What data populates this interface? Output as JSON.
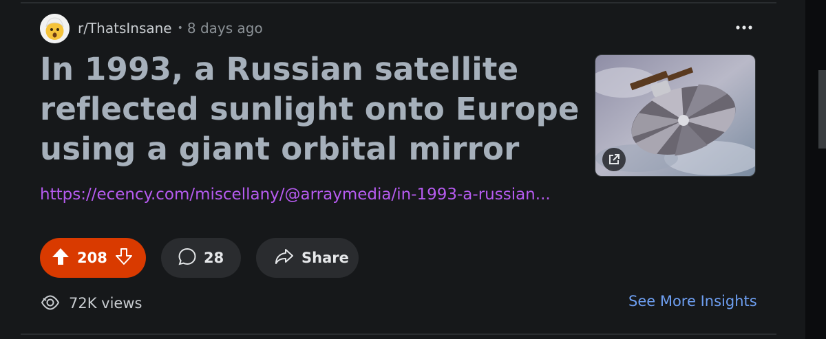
{
  "post": {
    "subreddit": "r/ThatsInsane",
    "separator": "•",
    "age": "8 days ago",
    "title": "In 1993, a Russian satellite reflected sunlight onto Europe using a giant orbital mirror",
    "link_text": "https://ecency.com/miscellany/@arraymedia/in-1993-a-russian...",
    "upvotes": "208",
    "comments": "28",
    "share_label": "Share",
    "views": "72K views",
    "insights_label": "See More Insights"
  },
  "colors": {
    "background": "#16181a",
    "title": "#a6b0bb",
    "link": "#b65bf0",
    "vote_active": "#d93a00",
    "pill": "#2a2c2f",
    "insights": "#6e9ff2"
  },
  "icons": {
    "avatar": "shocked-face-icon",
    "more": "more-horizontal-icon",
    "external_link": "external-link-icon",
    "upvote": "upvote-arrow-icon",
    "downvote": "downvote-arrow-icon",
    "comment": "comment-bubble-icon",
    "share": "share-arrow-icon",
    "views": "eye-icon"
  }
}
